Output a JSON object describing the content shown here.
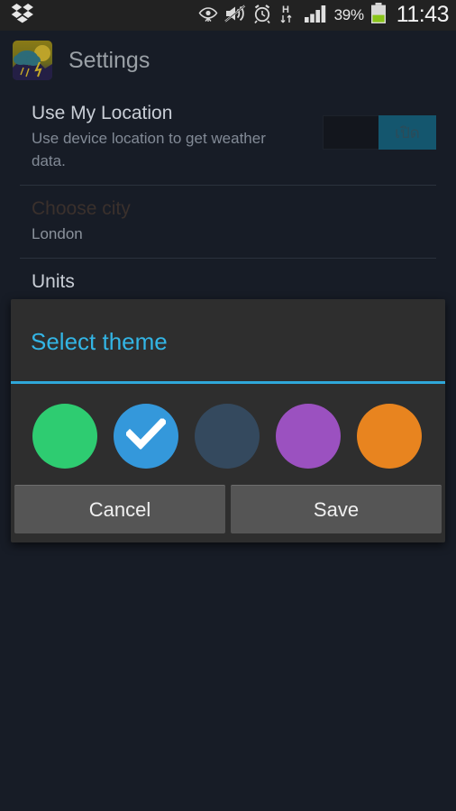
{
  "status_bar": {
    "left_icons": [
      {
        "name": "dropbox-icon"
      }
    ],
    "right_icons": [
      {
        "name": "smart-stay-eye-icon"
      },
      {
        "name": "sound-mute-icon"
      },
      {
        "name": "alarm-clock-icon"
      },
      {
        "name": "hspa-data-icon",
        "label": "H"
      },
      {
        "name": "signal-bars-icon"
      }
    ],
    "battery_percent": "39%",
    "battery_level": 39,
    "clock": "11:43"
  },
  "action_bar": {
    "app_icon": "weather-app-icon",
    "title": "Settings"
  },
  "settings": {
    "items": [
      {
        "title": "Use My Location",
        "summary": "Use device location to get weather data.",
        "toggle": {
          "state": "on",
          "label": "เปิด"
        }
      },
      {
        "title": "Choose city",
        "summary": "London",
        "disabled": true
      },
      {
        "title": "Units"
      }
    ]
  },
  "dialog": {
    "title": "Select theme",
    "accent_color": "#33b5e5",
    "swatches": [
      {
        "name": "theme-swatch-green",
        "color": "#2ecc71",
        "selected": false
      },
      {
        "name": "theme-swatch-blue",
        "color": "#3498db",
        "selected": true
      },
      {
        "name": "theme-swatch-slate",
        "color": "#34495e",
        "selected": false
      },
      {
        "name": "theme-swatch-purple",
        "color": "#9b51c0",
        "selected": false
      },
      {
        "name": "theme-swatch-orange",
        "color": "#e8841f",
        "selected": false
      }
    ],
    "cancel_label": "Cancel",
    "save_label": "Save"
  }
}
